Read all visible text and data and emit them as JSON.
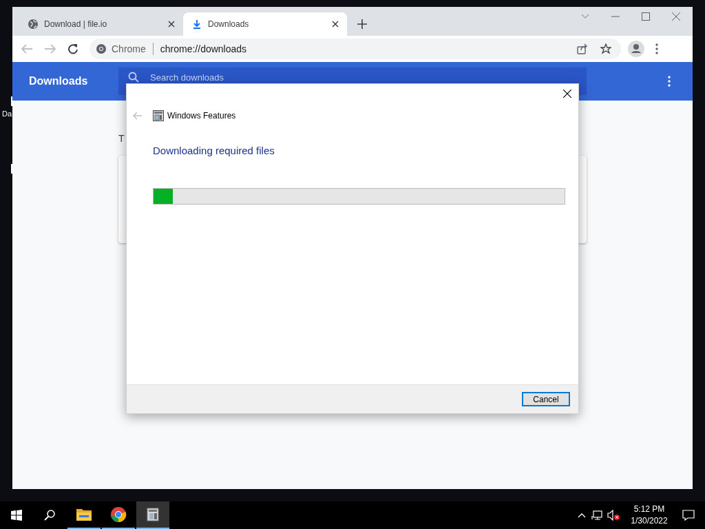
{
  "desktop": {
    "icon_labels": [
      "Da"
    ]
  },
  "browser": {
    "tabs": [
      {
        "title": "Download | file.io",
        "kind": "site",
        "selected": false
      },
      {
        "title": "Downloads",
        "kind": "downloads",
        "selected": true
      }
    ],
    "omnibox": {
      "site": "Chrome",
      "url": "chrome://downloads"
    },
    "page": {
      "title": "Downloads",
      "search": {
        "placeholder": "Search downloads"
      },
      "section_label": "T"
    }
  },
  "dialog": {
    "title": "Windows Features",
    "heading": "Downloading required files",
    "progress": {
      "level": 0.047
    },
    "buttons": [
      "Cancel"
    ]
  },
  "taskbar": {
    "apps": [
      {
        "kind": "folder",
        "selected": false
      },
      {
        "kind": "chrome",
        "selected": false
      },
      {
        "kind": "features",
        "selected": true
      }
    ],
    "time": "5:12 PM",
    "date": "1/30/2022"
  }
}
